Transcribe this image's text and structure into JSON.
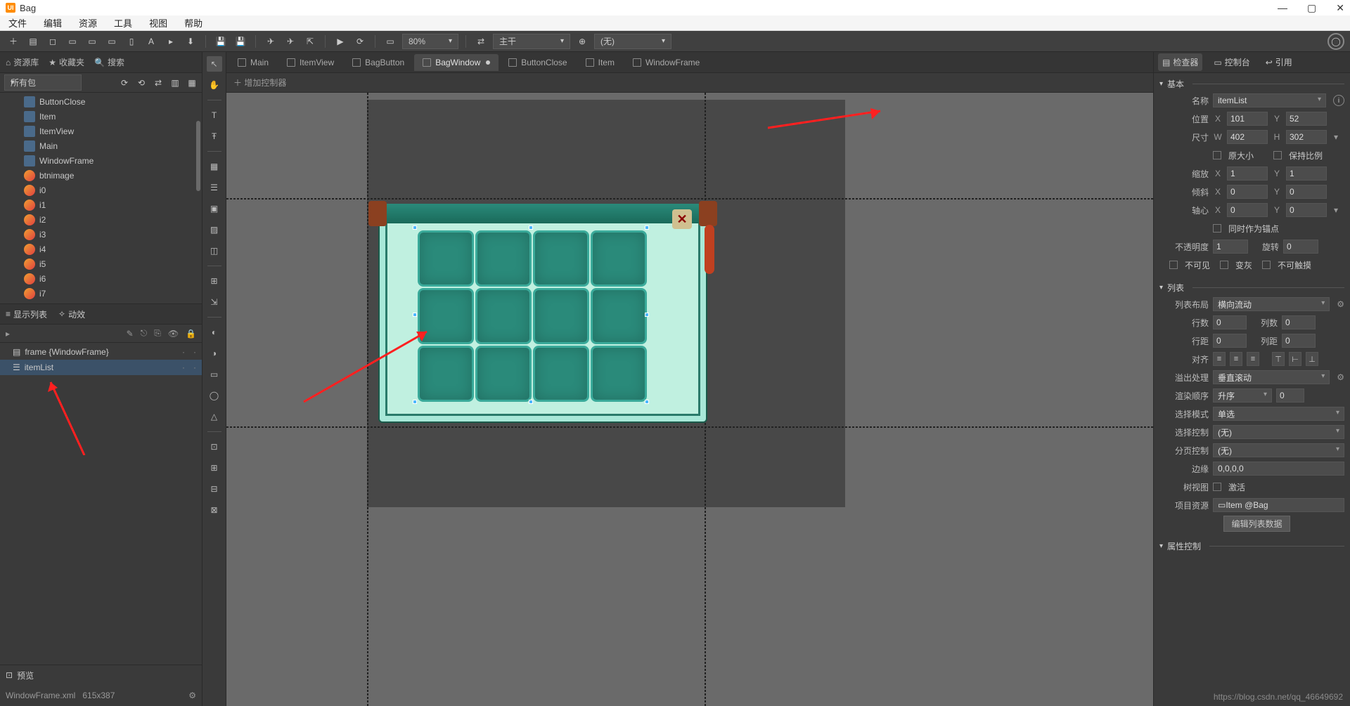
{
  "title": "Bag",
  "menubar": [
    "文件",
    "编辑",
    "资源",
    "工具",
    "视图",
    "帮助"
  ],
  "toolbar": {
    "zoom": "80%",
    "align_label": "主干",
    "branch_label": "(无)"
  },
  "left": {
    "tabs": {
      "library": "资源库",
      "fav": "收藏夹",
      "search": "搜索"
    },
    "filter": "所有包",
    "assets": [
      {
        "name": "ButtonClose",
        "type": "comp"
      },
      {
        "name": "Item",
        "type": "comp"
      },
      {
        "name": "ItemView",
        "type": "comp"
      },
      {
        "name": "Main",
        "type": "comp"
      },
      {
        "name": "WindowFrame",
        "type": "comp"
      },
      {
        "name": "btnimage",
        "type": "img"
      },
      {
        "name": "i0",
        "type": "img"
      },
      {
        "name": "i1",
        "type": "img"
      },
      {
        "name": "i2",
        "type": "img"
      },
      {
        "name": "i3",
        "type": "img"
      },
      {
        "name": "i4",
        "type": "img"
      },
      {
        "name": "i5",
        "type": "img"
      },
      {
        "name": "i6",
        "type": "img"
      },
      {
        "name": "i7",
        "type": "img"
      }
    ],
    "section_tabs": {
      "display": "显示列表",
      "effect": "动效"
    },
    "hierarchy": [
      {
        "label": "frame {WindowFrame}",
        "icon": "comp",
        "selected": false
      },
      {
        "label": "itemList",
        "icon": "list",
        "selected": true
      }
    ],
    "preview": {
      "title": "预览",
      "file": "WindowFrame.xml",
      "size": "615x387"
    }
  },
  "doc_tabs": [
    {
      "label": "Main",
      "active": false
    },
    {
      "label": "ItemView",
      "active": false
    },
    {
      "label": "BagButton",
      "active": false
    },
    {
      "label": "BagWindow",
      "active": true,
      "modified": true
    },
    {
      "label": "ButtonClose",
      "active": false
    },
    {
      "label": "Item",
      "active": false
    },
    {
      "label": "WindowFrame",
      "active": false
    }
  ],
  "controller_bar": "增加控制器",
  "right": {
    "tabs": {
      "inspector": "检查器",
      "console": "控制台",
      "ref": "引用"
    },
    "basic": {
      "title": "基本",
      "name_label": "名称",
      "name_value": "itemList",
      "pos_label": "位置",
      "x": "101",
      "y": "52",
      "size_label": "尺寸",
      "w": "402",
      "h": "302",
      "orig_size": "原大小",
      "keep_ratio": "保持比例",
      "scale_label": "缩放",
      "sx": "1",
      "sy": "1",
      "skew_label": "倾斜",
      "kx": "0",
      "ky": "0",
      "pivot_label": "轴心",
      "px": "0",
      "py": "0",
      "anchor": "同时作为锚点",
      "opacity_label": "不透明度",
      "opacity": "1",
      "rotate_label": "旋转",
      "rotate": "0",
      "invisible": "不可见",
      "gray": "变灰",
      "untouch": "不可触摸"
    },
    "list": {
      "title": "列表",
      "layout_label": "列表布局",
      "layout_value": "横向流动",
      "rows_label": "行数",
      "rows": "0",
      "cols_label": "列数",
      "cols": "0",
      "rowgap_label": "行距",
      "rowgap": "0",
      "colgap_label": "列距",
      "colgap": "0",
      "align_label": "对齐",
      "overflow_label": "溢出处理",
      "overflow_value": "垂直滚动",
      "render_label": "渲染顺序",
      "render_value": "升序",
      "render_num": "0",
      "selmode_label": "选择模式",
      "selmode_value": "单选",
      "selctrl_label": "选择控制",
      "selctrl_value": "(无)",
      "pagectrl_label": "分页控制",
      "pagectrl_value": "(无)",
      "margin_label": "边缘",
      "margin_value": "0,0,0,0",
      "tree_label": "树视图",
      "tree_chk": "激活",
      "itemres_label": "项目资源",
      "itemres_value": "Item @Bag",
      "edit_btn": "编辑列表数据"
    },
    "attr_ctrl": "属性控制"
  },
  "watermark": "https://blog.csdn.net/qq_46649692"
}
